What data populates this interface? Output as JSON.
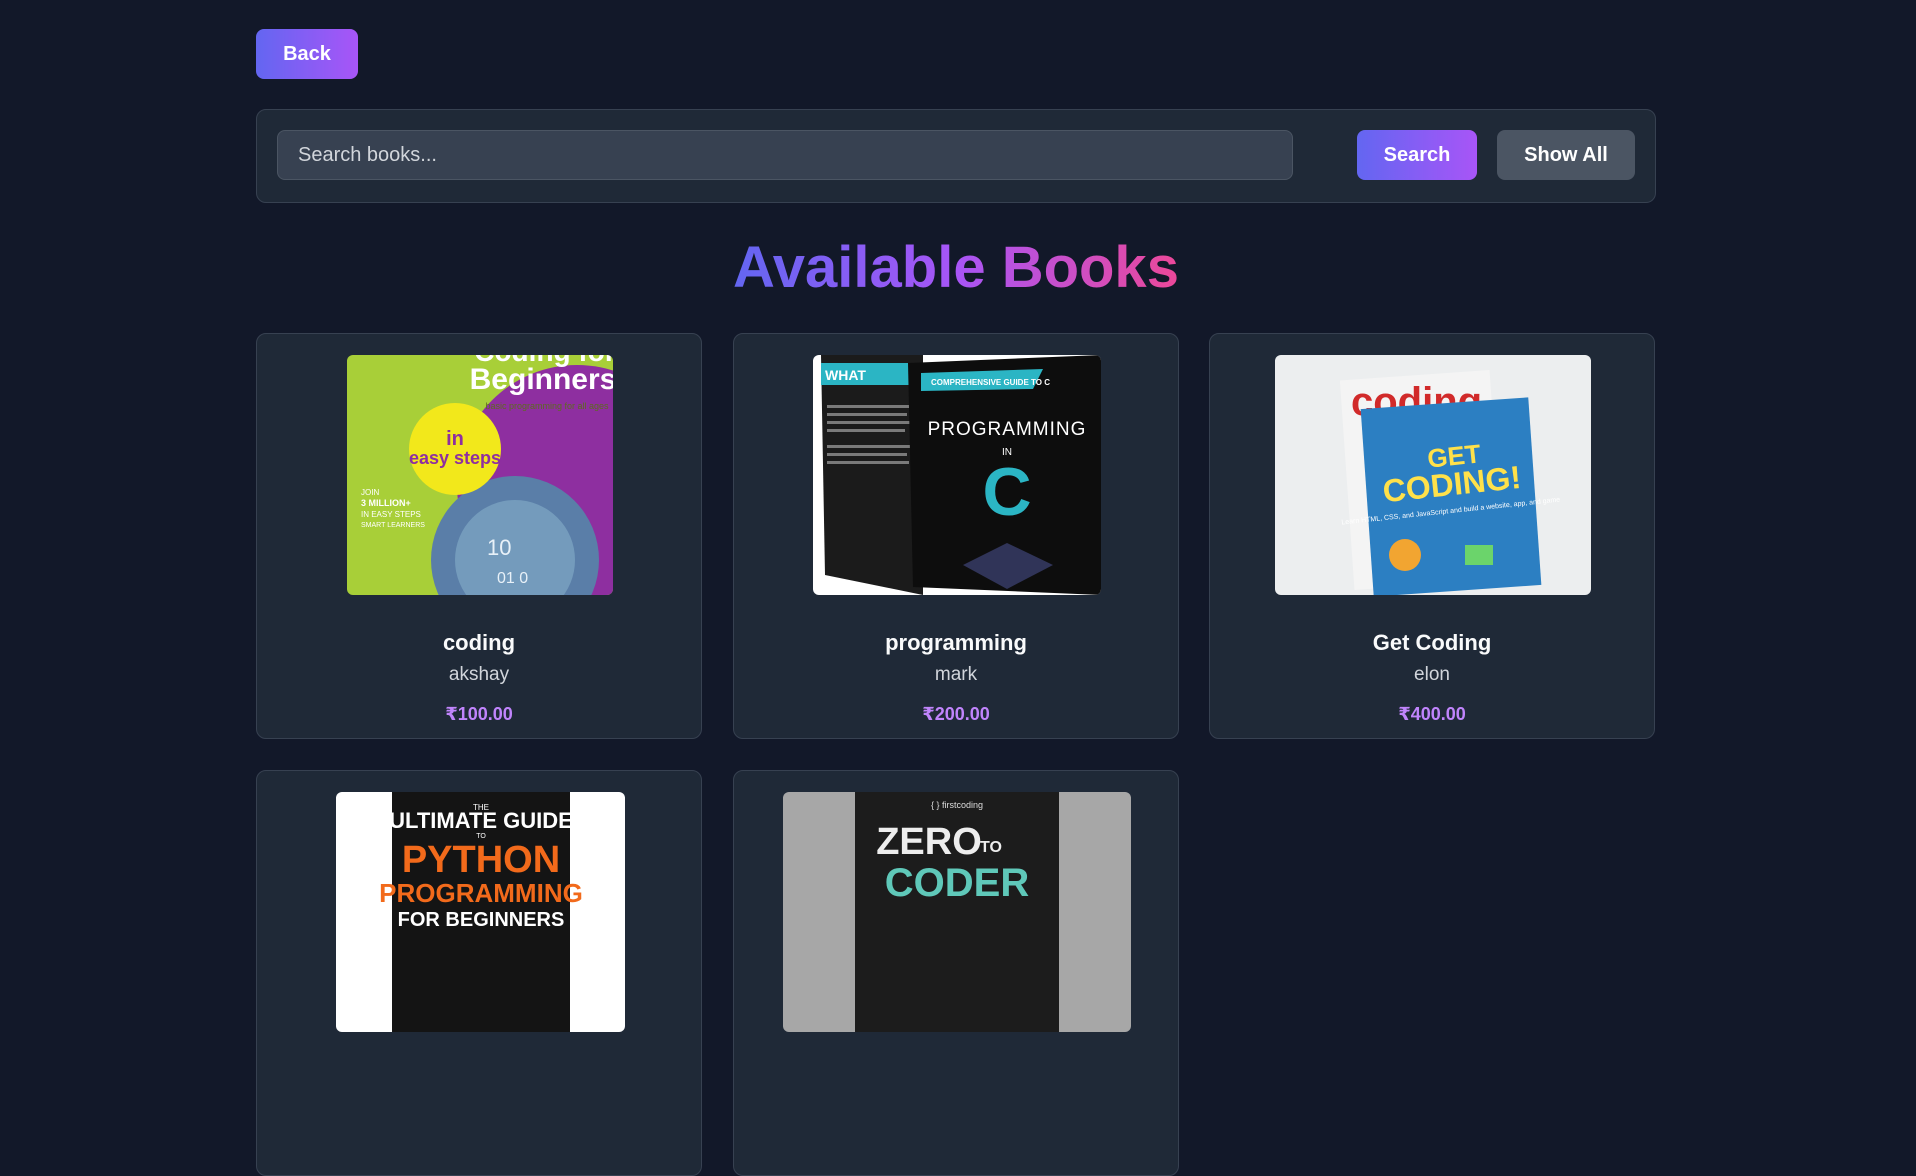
{
  "nav": {
    "back_label": "Back"
  },
  "search": {
    "placeholder": "Search books...",
    "value": "",
    "search_label": "Search",
    "show_all_label": "Show All"
  },
  "page_title": "Available Books",
  "books": [
    {
      "title": "coding",
      "author": "akshay",
      "price": "₹100.00",
      "cover": {
        "icon": "coding-for-beginners-cover",
        "line1": "Coding for",
        "line2": "Beginners",
        "sub": "basic programming for all ages",
        "badge_line1": "in",
        "badge_line2": "easy steps",
        "blurb_1": "JOIN",
        "blurb_2": "3 MILLION+",
        "blurb_3": "IN EASY STEPS",
        "blurb_4": "SMART LEARNERS"
      }
    },
    {
      "title": "programming",
      "author": "mark",
      "price": "₹200.00",
      "cover": {
        "icon": "programming-in-c-cover",
        "banner": "COMPREHENSIVE GUIDE TO C",
        "spine": "WHAT",
        "line1": "PROGRAMMING",
        "line2": "IN",
        "big": "C"
      }
    },
    {
      "title": "Get Coding",
      "author": "elon",
      "price": "₹400.00",
      "cover": {
        "icon": "get-coding-cover",
        "back_title": "coding",
        "line1": "GET",
        "line2": "CODING!",
        "sub": "Learn HTML, CSS, and JavaScript and build a website, app, and game"
      }
    },
    {
      "cover": {
        "icon": "python-guide-cover",
        "line1": "THE",
        "line2": "ULTIMATE GUIDE",
        "line3": "TO",
        "line4": "PYTHON",
        "line5": "PROGRAMMING",
        "line6": "FOR BEGINNERS"
      }
    },
    {
      "cover": {
        "icon": "zero-to-coder-cover",
        "brand": "{ } firstcoding",
        "line1": "ZERO",
        "line2": "TO",
        "line3": "CODER"
      }
    }
  ]
}
